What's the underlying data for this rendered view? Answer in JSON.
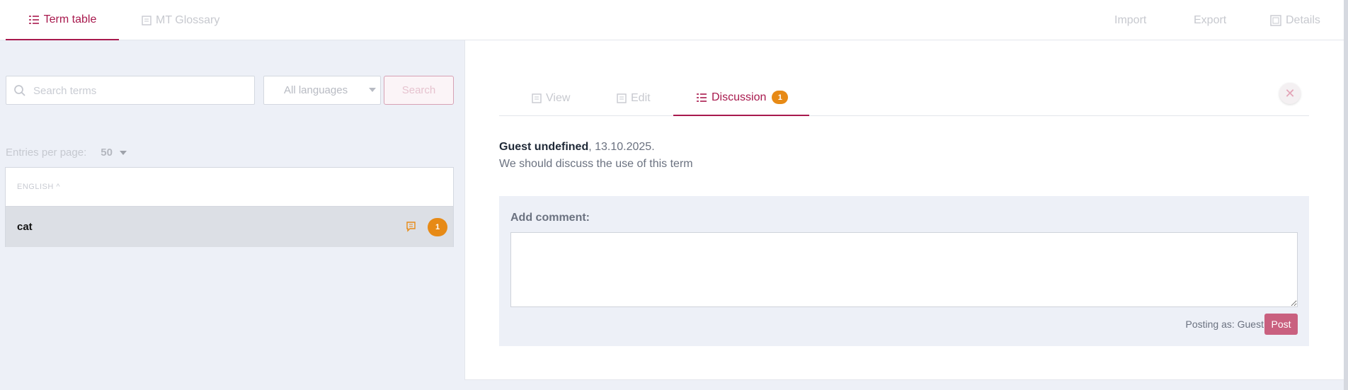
{
  "topbar": {
    "tabs": [
      {
        "label": "Term table",
        "icon": "list-icon",
        "active": true
      },
      {
        "label": "MT Glossary",
        "icon": "document-icon",
        "active": false
      }
    ],
    "actions": {
      "import": "Import",
      "export": "Export",
      "details": "Details"
    }
  },
  "search": {
    "placeholder": "Search terms",
    "value": "",
    "language_selected": "All languages",
    "button_label": "Search"
  },
  "pagination": {
    "label": "Entries per page:",
    "value": "50"
  },
  "term_table": {
    "column_header": "ENGLISH ^",
    "rows": [
      {
        "term": "cat",
        "comment_count": "1"
      }
    ]
  },
  "detail": {
    "tabs": {
      "view": "View",
      "edit": "Edit",
      "discussion": "Discussion",
      "discussion_count": "1"
    },
    "close_symbol": "✕",
    "comments": [
      {
        "author": "Guest undefined",
        "date": ", 13.10.2025.",
        "text": "We should discuss the use of this term"
      }
    ],
    "add_comment": {
      "label": "Add comment:",
      "value": "",
      "posting_as": "Posting as: Guest",
      "post_label": "Post"
    }
  },
  "colors": {
    "accent": "#a8194d",
    "badge": "#e78a16",
    "post_button": "#c9607f",
    "panel_bg": "#edf0f7"
  }
}
